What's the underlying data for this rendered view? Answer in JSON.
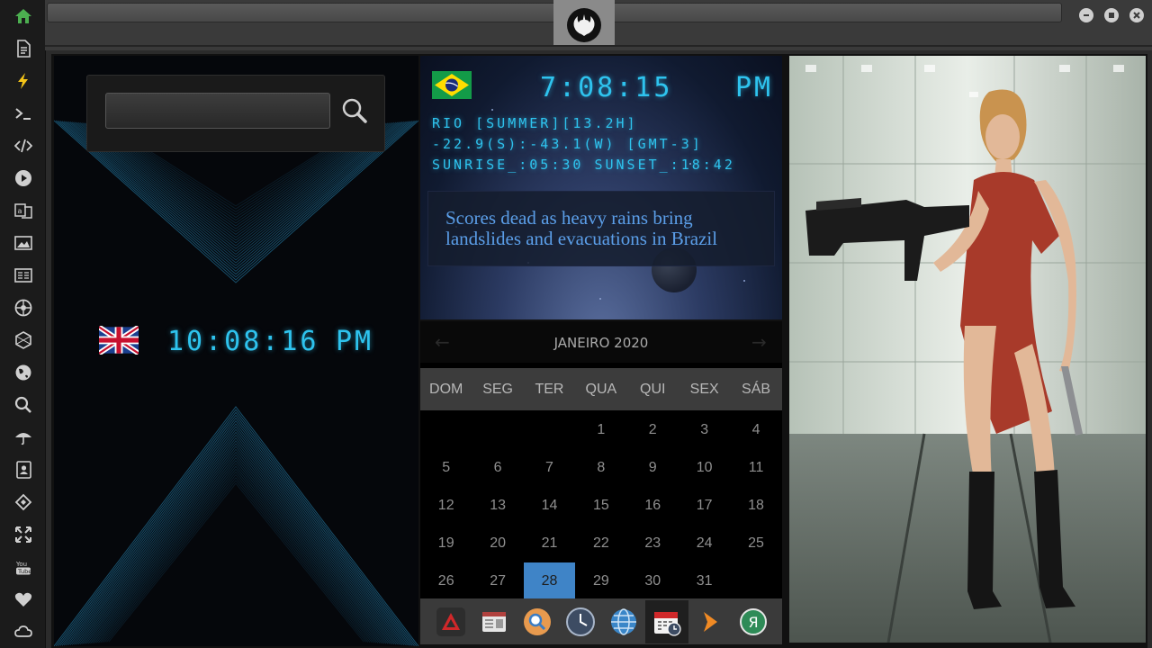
{
  "sidebar": {
    "icons": [
      "home-icon",
      "document-icon",
      "lightning-icon",
      "terminal-icon",
      "code-icon",
      "play-icon",
      "translate-icon",
      "image-icon",
      "news-icon",
      "aperture-icon",
      "hexagon-icon",
      "globe-icon",
      "search-icon",
      "umbrella-icon",
      "contacts-icon",
      "tag-icon",
      "expand-icon",
      "youtube-icon",
      "heart-icon",
      "cloud-icon"
    ],
    "youtube_label": "You\nTube",
    "home_color": "#4caf50",
    "lightning_color": "#f5c518"
  },
  "search": {
    "placeholder": "",
    "value": ""
  },
  "uk_clock": {
    "time": "10:08:16",
    "ampm": "PM"
  },
  "br_clock": {
    "time": "7:08:15",
    "ampm": "PM",
    "line1": "RIO [SUMMER][13.2H]",
    "line2": "-22.9(S):-43.1(W) [GMT-3]",
    "line3": "SUNRISE_:05:30 SUNSET_:18:42"
  },
  "news": {
    "headline": "Scores dead as heavy rains bring landslides and evacuations in Brazil"
  },
  "calendar": {
    "month": "JANEIRO 2020",
    "prev": "←",
    "next": "→",
    "weekdays": [
      "DOM",
      "SEG",
      "TER",
      "QUA",
      "QUI",
      "SEX",
      "SÁB"
    ],
    "leading_blanks": 3,
    "days": 31,
    "today": 28
  },
  "dock": {
    "apps": [
      "alert-app-icon",
      "news-app-icon",
      "search-app-icon",
      "clock-app-icon",
      "browser-app-icon",
      "calendar-app-icon",
      "arrow-app-icon",
      "translator-app-icon"
    ],
    "active": "calendar-app-icon",
    "translator_glyph": "Я"
  },
  "colors": {
    "digital": "#2ec3ee",
    "news_text": "#5b9ee8",
    "calendar_today": "#3f84c7"
  }
}
